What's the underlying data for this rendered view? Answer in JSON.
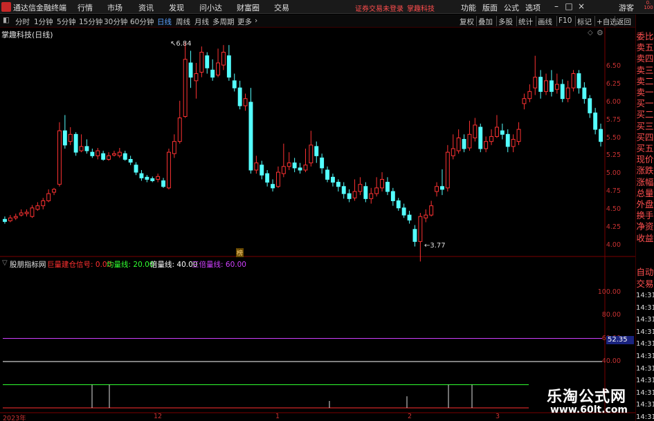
{
  "app": {
    "title": "通达信金融终端",
    "menu": [
      "行情",
      "市场",
      "资讯",
      "发现",
      "问小达",
      "财富圈",
      "交易"
    ],
    "notice": "证券交易未登录",
    "notice_stock": "掌趣科技",
    "right_menu": [
      "功能",
      "版面",
      "公式",
      "选项"
    ],
    "user": "游客"
  },
  "toolbar": {
    "periods": [
      "分时",
      "1分钟",
      "5分钟",
      "15分钟",
      "30分钟",
      "60分钟",
      "日线",
      "周线",
      "月线",
      "多周期",
      "更多"
    ],
    "active": "日线",
    "right_items": [
      "复权",
      "叠加",
      "多股",
      "统计",
      "画线",
      "F10",
      "标记",
      "+自选",
      "返回"
    ]
  },
  "kline_panel": {
    "title": "掌趣科技(日线)",
    "price_axis": [
      "6.50",
      "6.25",
      "6.00",
      "5.75",
      "5.50",
      "5.25",
      "5.00",
      "4.75",
      "4.50",
      "4.25",
      "4.00"
    ],
    "high_label": "6.84",
    "low_label": "3.77",
    "marker": "榜"
  },
  "indicator": {
    "name": "股朋指标网",
    "params": [
      {
        "label": "巨量建仓信号:",
        "value": "0.00",
        "color": "#ff3030"
      },
      {
        "label": "均量线:",
        "value": "20.00",
        "color": "#30ff30"
      },
      {
        "label": "倍量线:",
        "value": "40.00",
        "color": "#ffffff"
      },
      {
        "label": "三倍量线:",
        "value": "60.00",
        "color": "#d040ff"
      }
    ],
    "axis": [
      "100.00",
      "80.00",
      "60.00",
      "40.00"
    ],
    "readout": "52.35"
  },
  "right_panel": {
    "labels": [
      "委比",
      "卖五",
      "卖四",
      "卖三",
      "卖二",
      "卖一",
      "买一",
      "买二",
      "买三",
      "买四",
      "买五",
      "现价",
      "涨跌",
      "涨幅",
      "总量",
      "外盘",
      "换手",
      "净资",
      "收益"
    ],
    "lower_labels": [
      "自动",
      "交易"
    ],
    "times": [
      "14:31",
      "14:31",
      "14:31",
      "14:31",
      "14:31",
      "14:31",
      "14:31",
      "14:31",
      "14:31",
      "14:31",
      "14:31"
    ]
  },
  "date_axis": [
    "2023年",
    "12",
    "1",
    "2",
    "3"
  ],
  "watermark": {
    "title": "乐淘公式网",
    "url": "www.60lt.com"
  },
  "chart_data": {
    "type": "candlestick",
    "title": "掌趣科技(日线)",
    "ylim": [
      3.85,
      6.85
    ],
    "candles": [
      [
        4.36,
        4.33,
        4.4,
        4.3
      ],
      [
        4.34,
        4.38,
        4.42,
        4.32
      ],
      [
        4.38,
        4.4,
        4.44,
        4.35
      ],
      [
        4.42,
        4.45,
        4.5,
        4.4
      ],
      [
        4.44,
        4.46,
        4.5,
        4.4
      ],
      [
        4.4,
        4.52,
        4.56,
        4.38
      ],
      [
        4.5,
        4.55,
        4.6,
        4.48
      ],
      [
        4.55,
        4.62,
        4.66,
        4.5
      ],
      [
        4.62,
        4.72,
        4.78,
        4.6
      ],
      [
        4.74,
        4.78,
        4.8,
        4.7
      ],
      [
        4.85,
        5.6,
        5.72,
        4.82
      ],
      [
        5.6,
        5.4,
        5.82,
        5.35
      ],
      [
        5.45,
        5.55,
        5.65,
        5.4
      ],
      [
        5.55,
        5.3,
        5.58,
        5.25
      ],
      [
        5.32,
        5.38,
        5.55,
        5.3
      ],
      [
        5.38,
        5.32,
        5.48,
        5.28
      ],
      [
        5.3,
        5.25,
        5.35,
        5.22
      ],
      [
        5.25,
        5.32,
        5.36,
        5.2
      ],
      [
        5.28,
        5.2,
        5.32,
        5.18
      ],
      [
        5.2,
        5.25,
        5.3,
        5.18
      ],
      [
        5.26,
        5.28,
        5.32,
        5.24
      ],
      [
        5.25,
        5.3,
        5.36,
        5.22
      ],
      [
        5.28,
        5.2,
        5.32,
        5.18
      ],
      [
        5.2,
        5.16,
        5.25,
        5.12
      ],
      [
        5.12,
        5.02,
        5.16,
        4.98
      ],
      [
        5.0,
        4.94,
        5.05,
        4.9
      ],
      [
        4.95,
        4.92,
        4.98,
        4.88
      ],
      [
        4.93,
        4.9,
        4.96,
        4.88
      ],
      [
        4.92,
        4.96,
        5.0,
        4.88
      ],
      [
        4.9,
        4.82,
        4.94,
        4.8
      ],
      [
        4.8,
        5.3,
        5.35,
        4.78
      ],
      [
        5.28,
        5.45,
        5.55,
        5.22
      ],
      [
        5.45,
        5.78,
        6.02,
        5.42
      ],
      [
        5.8,
        6.6,
        6.84,
        5.78
      ],
      [
        6.55,
        6.35,
        6.72,
        6.2
      ],
      [
        6.3,
        6.4,
        6.55,
        6.05
      ],
      [
        6.42,
        6.7,
        6.78,
        6.35
      ],
      [
        6.65,
        6.48,
        6.7,
        6.4
      ],
      [
        6.45,
        6.35,
        6.6,
        6.3
      ],
      [
        6.38,
        6.55,
        6.75,
        6.35
      ],
      [
        6.52,
        6.7,
        6.8,
        6.45
      ],
      [
        6.65,
        6.35,
        6.8,
        6.3
      ],
      [
        6.3,
        6.2,
        6.4,
        6.15
      ],
      [
        6.2,
        5.95,
        6.3,
        5.9
      ],
      [
        5.95,
        6.05,
        6.12,
        5.88
      ],
      [
        6.0,
        5.05,
        6.2,
        5.0
      ],
      [
        5.05,
        5.15,
        5.25,
        5.0
      ],
      [
        5.12,
        4.98,
        5.18,
        4.92
      ],
      [
        5.0,
        4.88,
        5.05,
        4.82
      ],
      [
        4.85,
        4.8,
        4.92,
        4.75
      ],
      [
        4.82,
        5.02,
        5.1,
        4.8
      ],
      [
        5.0,
        5.1,
        5.42,
        4.95
      ],
      [
        5.1,
        5.15,
        5.3,
        5.05
      ],
      [
        5.15,
        5.08,
        5.22,
        5.02
      ],
      [
        5.08,
        5.05,
        5.15,
        5.0
      ],
      [
        5.05,
        5.12,
        5.35,
        5.02
      ],
      [
        5.15,
        5.4,
        5.6,
        5.1
      ],
      [
        5.38,
        5.25,
        5.45,
        5.15
      ],
      [
        5.22,
        5.08,
        5.28,
        5.0
      ],
      [
        5.05,
        4.92,
        5.1,
        4.88
      ],
      [
        4.95,
        4.88,
        5.0,
        4.82
      ],
      [
        4.88,
        4.82,
        4.92,
        4.75
      ],
      [
        4.82,
        4.72,
        4.88,
        4.65
      ],
      [
        4.72,
        4.65,
        4.78,
        4.6
      ],
      [
        4.66,
        4.75,
        4.92,
        4.62
      ],
      [
        4.75,
        4.85,
        4.95,
        4.7
      ],
      [
        4.82,
        4.65,
        4.88,
        4.6
      ],
      [
        4.65,
        4.72,
        4.8,
        4.58
      ],
      [
        4.72,
        4.8,
        4.95,
        4.68
      ],
      [
        4.8,
        4.92,
        5.02,
        4.75
      ],
      [
        4.88,
        4.75,
        4.95,
        4.7
      ],
      [
        4.75,
        4.62,
        4.8,
        4.55
      ],
      [
        4.62,
        4.52,
        4.66,
        4.48
      ],
      [
        4.52,
        4.42,
        4.58,
        4.38
      ],
      [
        4.42,
        4.35,
        4.48,
        4.3
      ],
      [
        4.22,
        4.05,
        4.28,
        3.98
      ],
      [
        4.05,
        4.4,
        4.45,
        3.77
      ],
      [
        4.38,
        4.42,
        4.5,
        4.32
      ],
      [
        4.42,
        4.55,
        4.62,
        4.4
      ],
      [
        4.75,
        4.82,
        4.88,
        4.68
      ],
      [
        4.82,
        4.78,
        5.06,
        4.7
      ],
      [
        4.8,
        5.3,
        5.4,
        4.75
      ],
      [
        5.25,
        5.35,
        5.55,
        5.2
      ],
      [
        5.32,
        5.5,
        5.62,
        5.28
      ],
      [
        5.48,
        5.35,
        5.55,
        5.3
      ],
      [
        5.36,
        5.55,
        5.74,
        5.32
      ],
      [
        5.5,
        5.68,
        5.78,
        5.45
      ],
      [
        5.65,
        5.35,
        5.7,
        5.3
      ],
      [
        5.35,
        5.45,
        5.52,
        5.3
      ],
      [
        5.45,
        5.52,
        5.62,
        5.4
      ],
      [
        5.52,
        5.65,
        5.82,
        5.5
      ],
      [
        5.6,
        5.55,
        5.7,
        5.48
      ],
      [
        5.55,
        5.38,
        5.62,
        5.3
      ],
      [
        5.38,
        5.48,
        5.55,
        5.3
      ],
      [
        5.45,
        5.62,
        5.72,
        5.4
      ],
      [
        5.98,
        6.05,
        6.12,
        5.9
      ],
      [
        6.05,
        6.15,
        6.25,
        6.0
      ],
      [
        6.2,
        6.35,
        6.65,
        6.1
      ],
      [
        6.35,
        6.15,
        6.45,
        6.05
      ],
      [
        6.15,
        6.3,
        6.4,
        6.1
      ],
      [
        6.3,
        6.15,
        6.45,
        6.08
      ],
      [
        6.18,
        6.25,
        6.4,
        6.12
      ],
      [
        6.25,
        6.05,
        6.32,
        6.0
      ],
      [
        6.05,
        6.2,
        6.3,
        6.0
      ],
      [
        6.2,
        6.4,
        6.45,
        6.15
      ],
      [
        6.4,
        6.2,
        6.45,
        6.12
      ],
      [
        6.2,
        6.05,
        6.28,
        5.98
      ],
      [
        6.05,
        5.85,
        6.1,
        5.78
      ],
      [
        5.85,
        5.62,
        5.92,
        5.55
      ],
      [
        5.62,
        5.45,
        5.7,
        5.38
      ]
    ],
    "indicator_lines": [
      {
        "name": "三倍量线",
        "value": 60,
        "color": "#d040ff"
      },
      {
        "name": "倍量线",
        "value": 40,
        "color": "#ffffff"
      },
      {
        "name": "均量线",
        "value": 20,
        "color": "#30ff30"
      }
    ],
    "indicator_ylim": [
      0,
      120
    ]
  }
}
